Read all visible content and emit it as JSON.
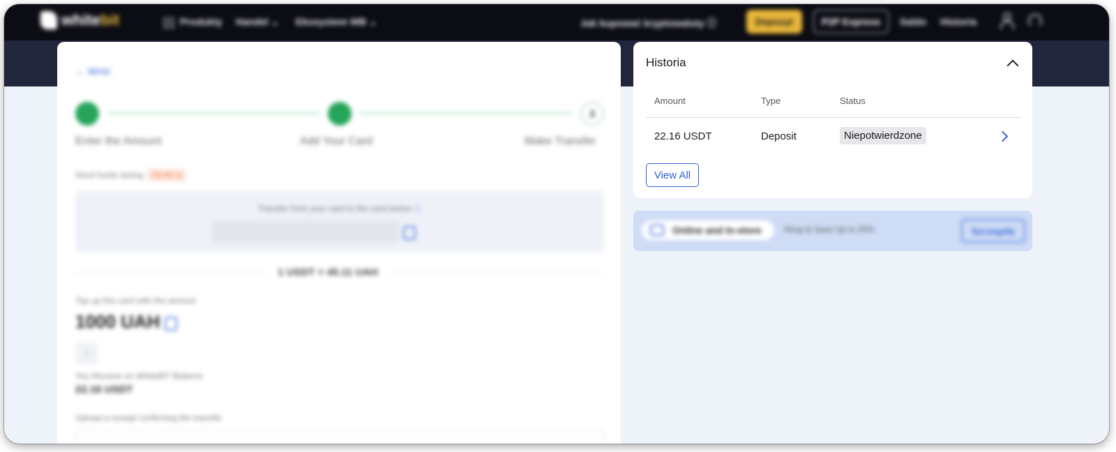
{
  "nav": {
    "logo_white": "white",
    "logo_bit": "bit",
    "links": [
      "Produkty",
      "Handel",
      "Ekosystem WB"
    ],
    "how_to_buy": "Jak kupować kryptowaluty",
    "deposit": "Depozyt",
    "p2p": "P2P Express",
    "balance": "Saldo",
    "history": "Historia"
  },
  "flow": {
    "back": "← Wróć",
    "steps": [
      {
        "label": "Enter the Amount",
        "status": "done"
      },
      {
        "label": "Add Your Card",
        "status": "done"
      },
      {
        "label": "Make Transfer",
        "status": "current",
        "number": "3"
      }
    ],
    "send_funds_label": "Send funds during",
    "timer": "29:49",
    "transfer_label": "Transfer from your card to the card below",
    "rate": "1 USDT = 45.11 UAH",
    "topup_label": "Top up this card with the amount",
    "amount": "1000 UAH",
    "receive_label": "You Receive on WhiteBIT Balance",
    "receive_value": "22.16 USDT",
    "upload_label": "Upload a receipt confirming the transfer"
  },
  "history": {
    "title": "Historia",
    "columns": [
      "Amount",
      "Type",
      "Status"
    ],
    "rows": [
      {
        "amount": "22.16 USDT",
        "type": "Deposit",
        "status": "Niepotwierdzone"
      }
    ],
    "view_all": "View All"
  },
  "promo": {
    "pill": "Online and In-store",
    "text": "Shop & Save Up to 25%",
    "button": "Szczegóły"
  },
  "colors": {
    "accent": "#2f5fd6",
    "nav_bg": "#0c0d14",
    "deposit_button": "#e8b63a",
    "step_done": "#25a559",
    "timer": "#f07a4a"
  }
}
